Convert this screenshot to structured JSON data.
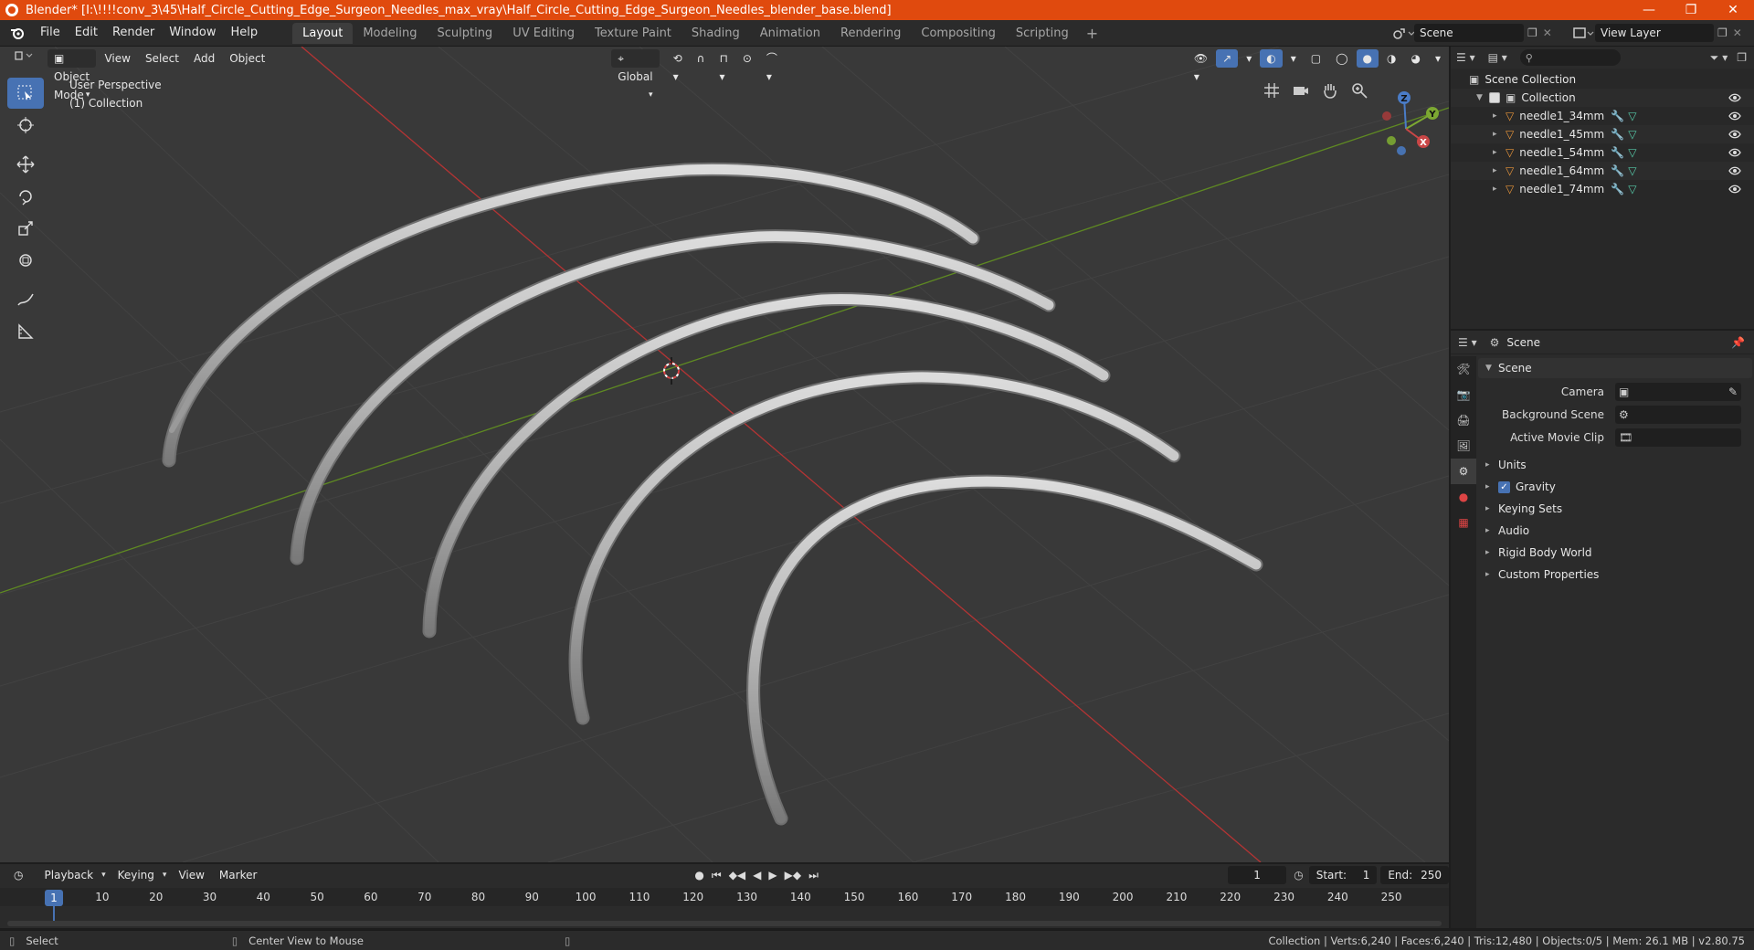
{
  "window": {
    "title": "Blender* [I:\\!!!!conv_3\\45\\Half_Circle_Cutting_Edge_Surgeon_Needles_max_vray\\Half_Circle_Cutting_Edge_Surgeon_Needles_blender_base.blend]",
    "minimize": "—",
    "maximize": "❐",
    "close": "✕"
  },
  "menu": [
    "File",
    "Edit",
    "Render",
    "Window",
    "Help"
  ],
  "workspaces": [
    "Layout",
    "Modeling",
    "Sculpting",
    "UV Editing",
    "Texture Paint",
    "Shading",
    "Animation",
    "Rendering",
    "Compositing",
    "Scripting"
  ],
  "active_workspace": "Layout",
  "scene_name": "Scene",
  "view_layer": "View Layer",
  "viewport": {
    "mode": "Object Mode",
    "menus": [
      "View",
      "Select",
      "Add",
      "Object"
    ],
    "transform": "Global",
    "perspective_label": "User Perspective",
    "collection_label": "(1) Collection",
    "gizmo": {
      "x": "X",
      "y": "Y",
      "z": "Z"
    }
  },
  "outliner": {
    "root": "Scene Collection",
    "collection": "Collection",
    "objects": [
      "needle1_34mm",
      "needle1_45mm",
      "needle1_54mm",
      "needle1_64mm",
      "needle1_74mm"
    ]
  },
  "properties": {
    "context": "Scene",
    "panel": "Scene",
    "camera_label": "Camera",
    "background_scene_label": "Background Scene",
    "active_movie_clip_label": "Active Movie Clip",
    "subpanels": [
      "Units",
      "Gravity",
      "Keying Sets",
      "Audio",
      "Rigid Body World",
      "Custom Properties"
    ]
  },
  "timeline": {
    "menus": [
      "Playback",
      "Keying",
      "View",
      "Marker"
    ],
    "current_frame": "1",
    "start_label": "Start:",
    "start": "1",
    "end_label": "End:",
    "end": "250",
    "ticks": [
      "1",
      "10",
      "20",
      "30",
      "40",
      "50",
      "60",
      "70",
      "80",
      "90",
      "100",
      "110",
      "120",
      "130",
      "140",
      "150",
      "160",
      "170",
      "180",
      "190",
      "200",
      "210",
      "220",
      "230",
      "240",
      "250"
    ]
  },
  "status": {
    "select": "Select",
    "center": "Center View to Mouse",
    "stats": "Collection | Verts:6,240 | Faces:6,240 | Tris:12,480 | Objects:0/5 | Mem: 26.1 MB | v2.80.75"
  },
  "colors": {
    "accent": "#4772b3",
    "titlebar": "#e04a0e",
    "x_axis": "#c83d3d",
    "y_axis": "#6a9a2a",
    "object_orange": "#e8953a"
  }
}
